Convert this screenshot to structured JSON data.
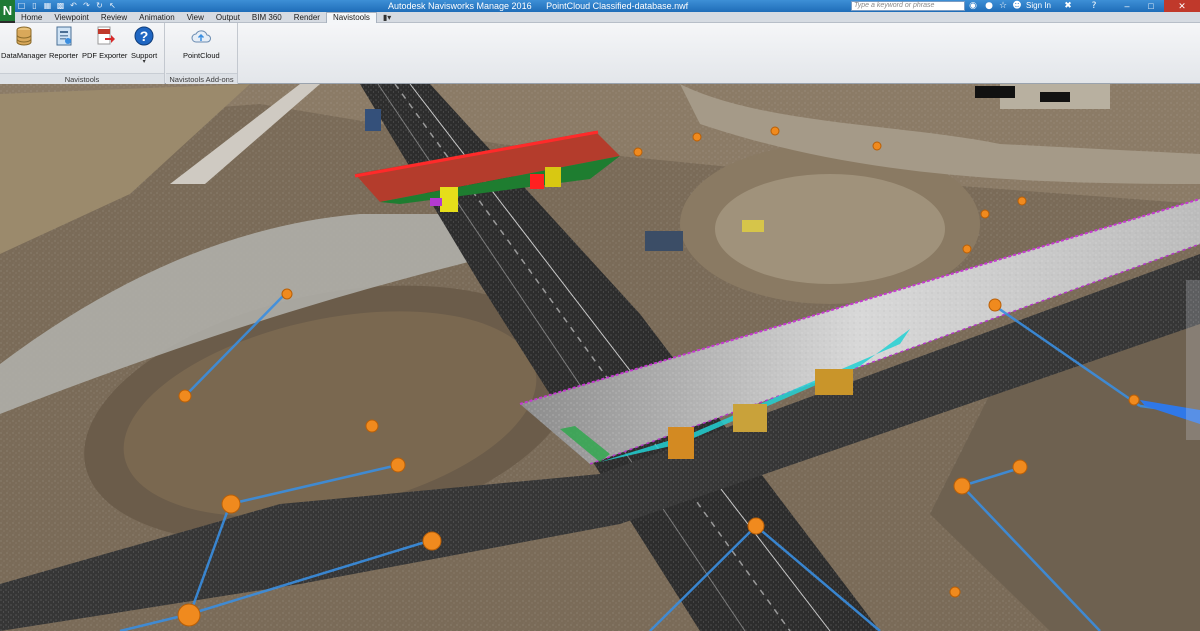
{
  "window": {
    "app_title": "Autodesk Navisworks Manage 2016",
    "file_name": "PointCloud Classified-database.nwf",
    "search_placeholder": "Type a keyword or phrase",
    "sign_in": "Sign In",
    "app_logo_letter": "N"
  },
  "tabs": [
    {
      "label": "Home"
    },
    {
      "label": "Viewpoint"
    },
    {
      "label": "Review"
    },
    {
      "label": "Animation"
    },
    {
      "label": "View"
    },
    {
      "label": "Output"
    },
    {
      "label": "BIM 360"
    },
    {
      "label": "Render"
    },
    {
      "label": "Navistools",
      "active": true
    }
  ],
  "ribbon": {
    "panels": [
      {
        "title": "Navistools",
        "buttons": [
          {
            "label": "DataManager",
            "icon": "database-icon"
          },
          {
            "label": "Reporter",
            "icon": "report-icon"
          },
          {
            "label": "PDF Exporter",
            "icon": "pdf-export-icon"
          },
          {
            "label": "Support",
            "icon": "help-icon",
            "has_dropdown": true
          }
        ]
      },
      {
        "title": "Navistools Add-ons",
        "buttons": [
          {
            "label": "PointCloud",
            "icon": "cloud-upload-icon"
          }
        ]
      }
    ]
  },
  "colors": {
    "titlebar": "#2a7cc7",
    "ribbon_bg": "#eceef1",
    "accent_orange": "#f08a1e",
    "link_blue": "#3a8ee0",
    "bridge_red": "#e02020",
    "bridge_cyan": "#20d8d8"
  }
}
